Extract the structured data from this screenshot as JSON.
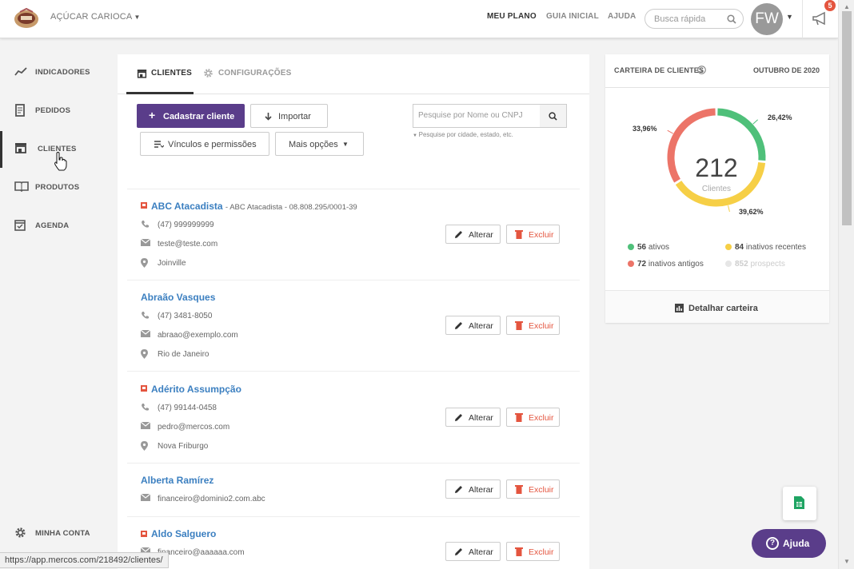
{
  "header": {
    "company": "AÇÚCAR CARIOCA",
    "nav": [
      "MEU PLANO",
      "GUIA INICIAL",
      "AJUDA"
    ],
    "search_placeholder": "Busca rápida",
    "avatar_initials": "FW",
    "notifications": "5"
  },
  "sidebar": {
    "items": [
      {
        "label": "INDICADORES",
        "icon": "trend-icon"
      },
      {
        "label": "PEDIDOS",
        "icon": "document-icon"
      },
      {
        "label": "CLIENTES",
        "icon": "store-icon",
        "active": true
      },
      {
        "label": "PRODUTOS",
        "icon": "book-icon"
      },
      {
        "label": "AGENDA",
        "icon": "calendar-icon"
      }
    ],
    "account": "MINHA CONTA"
  },
  "tabs": [
    "CLIENTES",
    "CONFIGURAÇÕES"
  ],
  "actions": {
    "create": "Cadastrar cliente",
    "import": "Importar",
    "links": "Vínculos e permissões",
    "more": "Mais opções",
    "search_placeholder": "Pesquise por Nome ou CNPJ",
    "search_hint": "Pesquise por cidade, estado, etc."
  },
  "row_actions": {
    "edit": "Alterar",
    "delete": "Excluir"
  },
  "clients": [
    {
      "name": "ABC Atacadista",
      "subtitle": "- ABC Atacadista - 08.808.295/0001-39",
      "flag": true,
      "phone": "(47) 999999999",
      "email": "teste@teste.com",
      "city": "Joinville"
    },
    {
      "name": "Abraão Vasques",
      "subtitle": "",
      "flag": false,
      "phone": "(47) 3481-8050",
      "email": "abraao@exemplo.com",
      "city": "Rio de Janeiro"
    },
    {
      "name": "Adérito Assumpção",
      "subtitle": "",
      "flag": true,
      "phone": "(47) 99144-0458",
      "email": "pedro@mercos.com",
      "city": "Nova Friburgo"
    },
    {
      "name": "Alberta Ramírez",
      "subtitle": "",
      "flag": false,
      "phone": "",
      "email": "financeiro@dominio2.com.abc",
      "city": ""
    },
    {
      "name": "Aldo Salguero",
      "subtitle": "",
      "flag": true,
      "phone": "",
      "email": "financeiro@aaaaaa.com",
      "city": ""
    }
  ],
  "portfolio": {
    "title": "CARTEIRA DE CLIENTES",
    "period": "OUTUBRO DE 2020",
    "total": "212",
    "total_label": "Clientes",
    "legend": [
      {
        "count": "56",
        "label": "ativos",
        "color": "#4fc07a"
      },
      {
        "count": "84",
        "label": "inativos recentes",
        "color": "#f6cf46"
      },
      {
        "count": "72",
        "label": "inativos antigos",
        "color": "#ec7468"
      },
      {
        "count": "852",
        "label": "prospects",
        "color": "#dddddd"
      }
    ],
    "detail": "Detalhar carteira"
  },
  "chart_data": {
    "type": "pie",
    "categories": [
      "ativos",
      "inativos recentes",
      "inativos antigos"
    ],
    "values": [
      26.42,
      39.62,
      33.96
    ],
    "labels": [
      "26,42%",
      "39,62%",
      "33,96%"
    ],
    "colors": [
      "#4fc07a",
      "#f6cf46",
      "#ec7468"
    ]
  },
  "help_label": "Ajuda",
  "status_url": "https://app.mercos.com/218492/clientes/"
}
